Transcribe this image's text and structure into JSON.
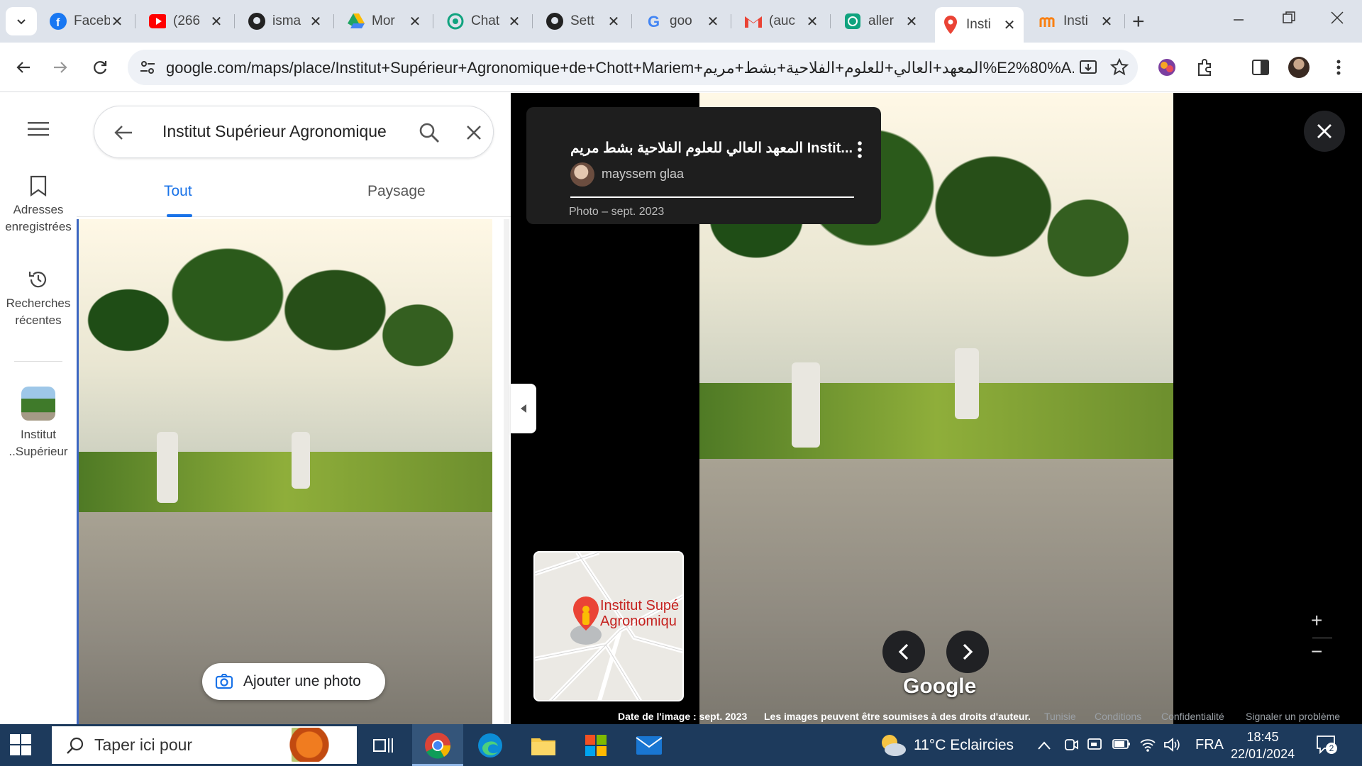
{
  "browser": {
    "tabs": [
      {
        "title": "Facebook",
        "icon": "facebook-icon"
      },
      {
        "title": "(266",
        "icon": "youtube-icon"
      },
      {
        "title": "isma",
        "icon": "github-icon"
      },
      {
        "title": "Mor",
        "icon": "google-drive-icon"
      },
      {
        "title": "Chat",
        "icon": "chatgpt-icon"
      },
      {
        "title": "Sett",
        "icon": "github-icon"
      },
      {
        "title": "goo",
        "icon": "google-icon"
      },
      {
        "title": "(auc",
        "icon": "gmail-icon"
      },
      {
        "title": "aller",
        "icon": "chatgpt-icon"
      },
      {
        "title": "Insti",
        "icon": "google-maps-icon"
      },
      {
        "title": "Insti",
        "icon": "moodle-icon"
      }
    ],
    "url": "google.com/maps/place/Institut+Supérieur+Agronomique+de+Chott+Mariem+المعهد+العالي+للعلوم+الفلاحية+بشط+مريم%E2%80%A..."
  },
  "maps": {
    "rail": {
      "saved_line1": "Adresses",
      "saved_line2": "enregistrées",
      "recent_line1": "Recherches",
      "recent_line2": "récentes",
      "place_line1": "Institut",
      "place_line2": "..Supérieur"
    },
    "search": {
      "value": "Institut Supérieur Agronomique"
    },
    "tabs": {
      "all": "Tout",
      "landscape": "Paysage"
    },
    "add_photo": "Ajouter une photo"
  },
  "viewer": {
    "title": "المعهد العالي للعلوم الفلاحية بشط مريم Instit...",
    "author": "mayssem glaa",
    "date": "Photo – sept. 2023",
    "minimap_label_line1": "Institut Supé",
    "minimap_label_line2": "Agronomiqu",
    "logo": "Google",
    "footer": {
      "image_date": "Date de l'image : sept. 2023",
      "copyright": "Les images peuvent être soumises à des droits d'auteur.",
      "country": "Tunisie",
      "terms": "Conditions",
      "privacy": "Confidentialité",
      "report": "Signaler un problème"
    }
  },
  "taskbar": {
    "search_placeholder": "Taper ici pour",
    "weather": "11°C  Eclaircies",
    "lang": "FRA",
    "time": "18:45",
    "date": "22/01/2024",
    "notif_count": "2"
  },
  "colors": {
    "accent": "#1a73e8",
    "taskbar": "#1d3a5c",
    "tabstrip": "#dee3eb"
  }
}
